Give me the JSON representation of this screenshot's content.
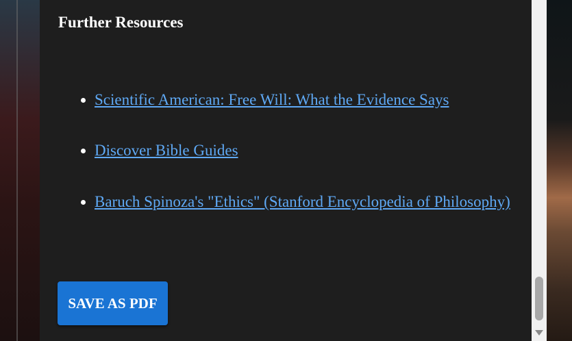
{
  "section": {
    "title": "Further Resources"
  },
  "resources": [
    {
      "label": "Scientific American: Free Will: What the Evidence Says"
    },
    {
      "label": "Discover Bible Guides"
    },
    {
      "label": "Baruch Spinoza's \"Ethics\" (Stanford Encyclopedia of Philosophy)"
    }
  ],
  "actions": {
    "save_pdf_label": "SAVE AS PDF"
  },
  "colors": {
    "link": "#5fa9f5",
    "button": "#1a74d4",
    "panel": "#1e1e1e"
  },
  "icons": {
    "scroll_down": "chevron-down-icon"
  }
}
